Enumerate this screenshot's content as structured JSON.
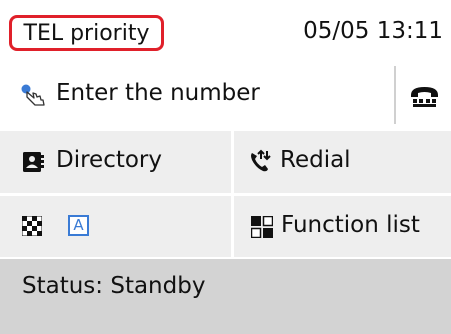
{
  "header": {
    "mode": "TEL priority",
    "datetime": "05/05 13:11"
  },
  "number_entry": {
    "label": "Enter the number",
    "icon": "finger-tap-icon"
  },
  "hook": {
    "icon": "phone-hook-icon"
  },
  "menu": {
    "directory": {
      "label": "Directory",
      "icon": "address-book-icon"
    },
    "redial": {
      "label": "Redial",
      "icon": "redial-icon"
    },
    "quality": {
      "resolution_icon": "checkerboard-icon",
      "text_mode_icon": "letter-a-icon",
      "text_mode_letter": "A"
    },
    "function_list": {
      "label": "Function list",
      "icon": "grid-icon"
    }
  },
  "status": {
    "text": "Status: Standby"
  },
  "colors": {
    "badge_border": "#e0202a",
    "button_bg": "#eeeeee",
    "status_bg": "#d3d3d3",
    "accent_blue": "#3a7bd5"
  }
}
